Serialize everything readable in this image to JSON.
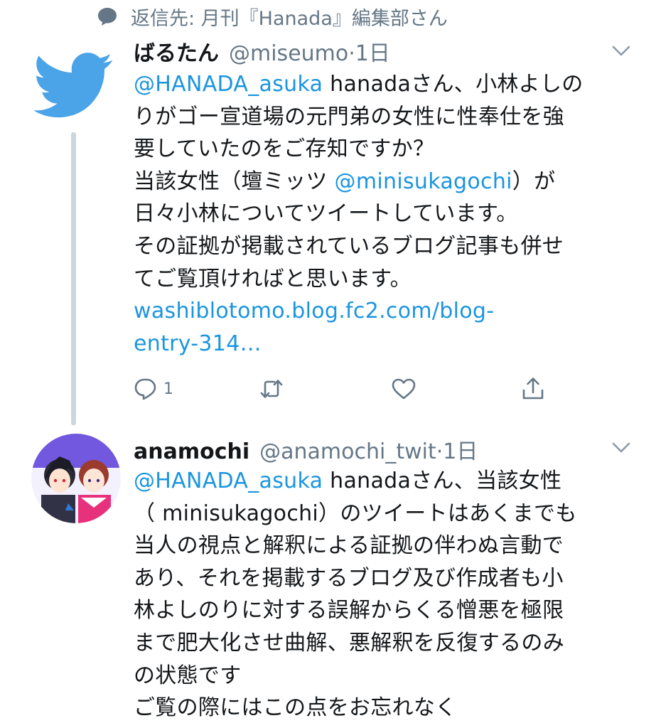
{
  "reply_context": {
    "text": "返信先: 月刊『Hanada』編集部さん"
  },
  "tweets": [
    {
      "name": "ばるたん",
      "handle": "@miseumo",
      "separator": "·",
      "time": "1日",
      "avatar": "twitter-bird-icon",
      "lines": [
        [
          {
            "text": "@HANADA_asuka",
            "link": true
          },
          {
            "text": " hanadaさん、小林よしの",
            "link": false
          }
        ],
        [
          {
            "text": "りがゴー宣道場の元門弟の女性に性奉仕を強",
            "link": false
          }
        ],
        [
          {
            "text": "要していたのをご存知ですか？",
            "link": false
          }
        ],
        [
          {
            "text": "当該女性（壇ミッツ ",
            "link": false
          },
          {
            "text": "@minisukagochi",
            "link": true
          },
          {
            "text": "）が",
            "link": false
          }
        ],
        [
          {
            "text": "日々小林についてツイートしています。",
            "link": false
          }
        ],
        [
          {
            "text": "その証拠が掲載されているブログ記事も併せ",
            "link": false
          }
        ],
        [
          {
            "text": "てご覧頂ければと思います。",
            "link": false
          }
        ],
        [
          {
            "text": "washiblotomo.blog.fc2.com/blog-",
            "link": true
          }
        ],
        [
          {
            "text": "entry-314…",
            "link": true
          }
        ]
      ],
      "actions": {
        "reply_count": "1",
        "retweet_count": "",
        "like_count": ""
      }
    },
    {
      "name": "anamochi",
      "handle": "@anamochi_twit",
      "separator": "·",
      "time": "1日",
      "avatar": "anime-avatar",
      "lines": [
        [
          {
            "text": "@HANADA_asuka",
            "link": true
          },
          {
            "text": " hanadaさん、当該女性",
            "link": false
          }
        ],
        [
          {
            "text": "（ minisukagochi）のツイートはあくまでも",
            "link": false
          }
        ],
        [
          {
            "text": "当人の視点と解釈による証拠の伴わぬ言動で",
            "link": false
          }
        ],
        [
          {
            "text": "あり、それを掲載するブログ及び作成者も小",
            "link": false
          }
        ],
        [
          {
            "text": "林よしのりに対する誤解からくる憎悪を極限",
            "link": false
          }
        ],
        [
          {
            "text": "まで肥大化させ曲解、悪解釈を反復するのみ",
            "link": false
          }
        ],
        [
          {
            "text": "の状態です",
            "link": false
          }
        ],
        [
          {
            "text": "ご覧の際にはこの点をお忘れなく",
            "link": false
          }
        ]
      ]
    }
  ],
  "colors": {
    "link": "#1b95e0",
    "muted": "#657786",
    "text": "#14171a",
    "thread_line": "#ccd6dd",
    "bird": "#4ba3e8"
  }
}
